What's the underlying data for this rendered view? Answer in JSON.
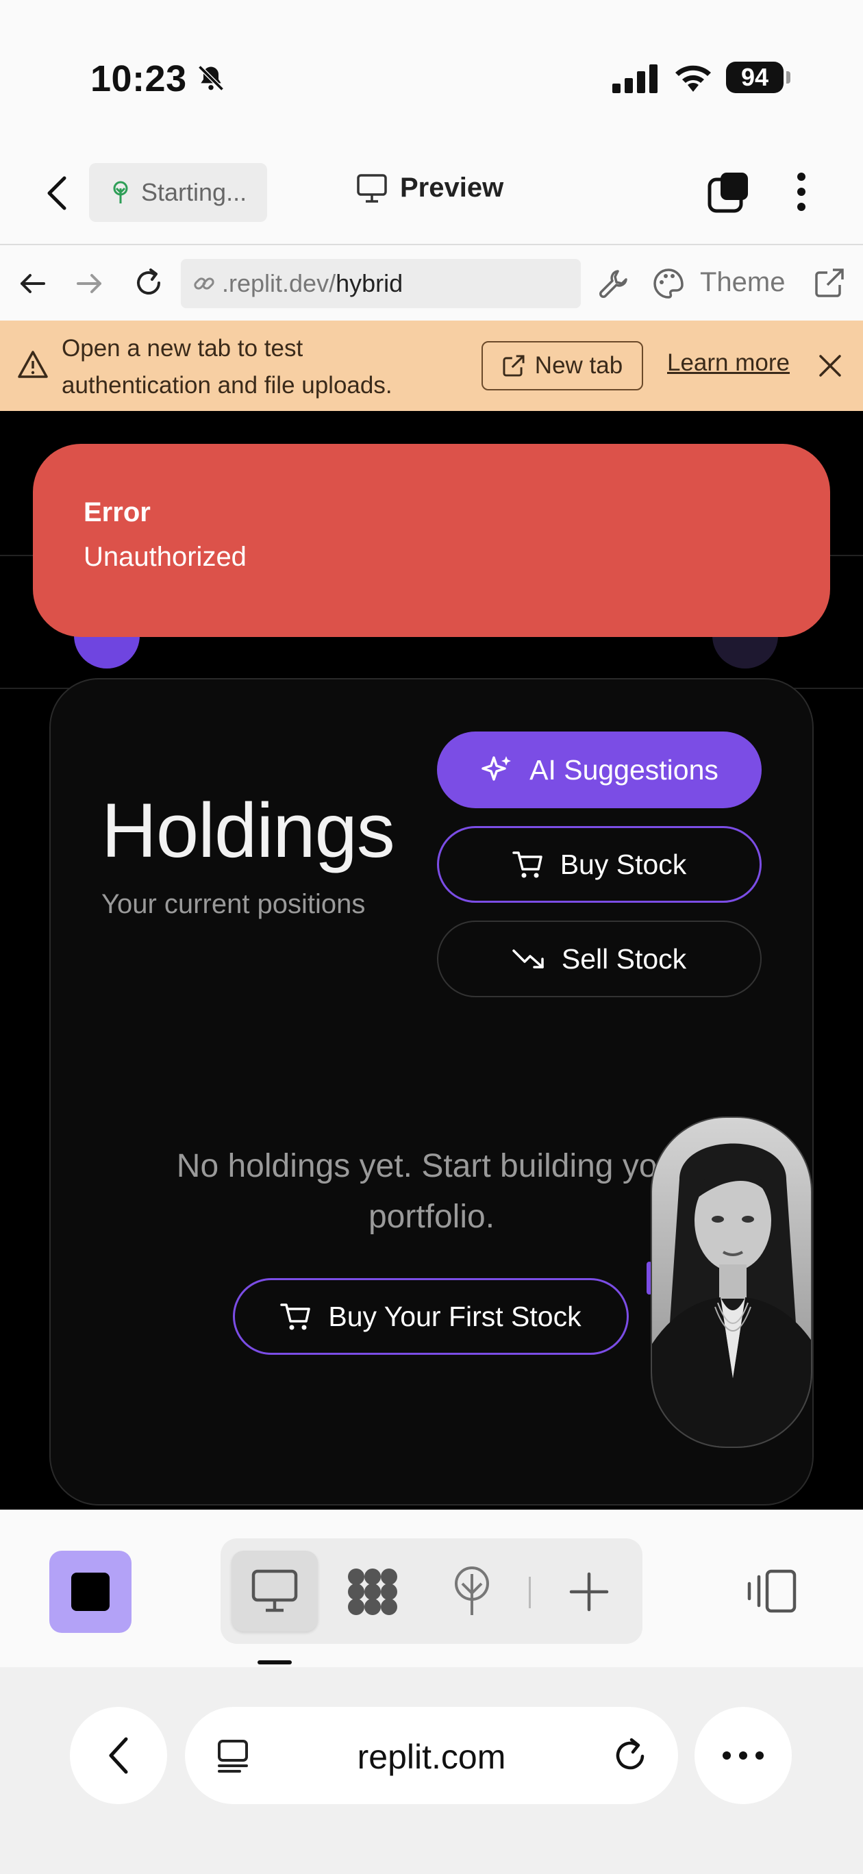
{
  "status_bar": {
    "time": "10:23",
    "battery": "94"
  },
  "header": {
    "starting_label": "Starting...",
    "preview_label": "Preview"
  },
  "url_bar": {
    "domain": ".replit.dev/",
    "path": "hybrid",
    "theme_label": "Theme"
  },
  "banner": {
    "message": "Open a new tab to test authentication and file uploads.",
    "new_tab_label": "New tab",
    "learn_more_label": "Learn more"
  },
  "toast": {
    "title": "Error",
    "message": "Unauthorized"
  },
  "holdings": {
    "title": "Holdings",
    "subtitle": "Your current positions",
    "ai_button": "AI Suggestions",
    "buy_button": "Buy Stock",
    "sell_button": "Sell Stock",
    "empty_message": "No holdings yet. Start building your portfolio.",
    "first_stock_button": "Buy Your First Stock"
  },
  "browser": {
    "address": "replit.com"
  },
  "colors": {
    "accent": "#7b4de5",
    "error": "#dc524a",
    "banner": "#f7cfa3"
  }
}
